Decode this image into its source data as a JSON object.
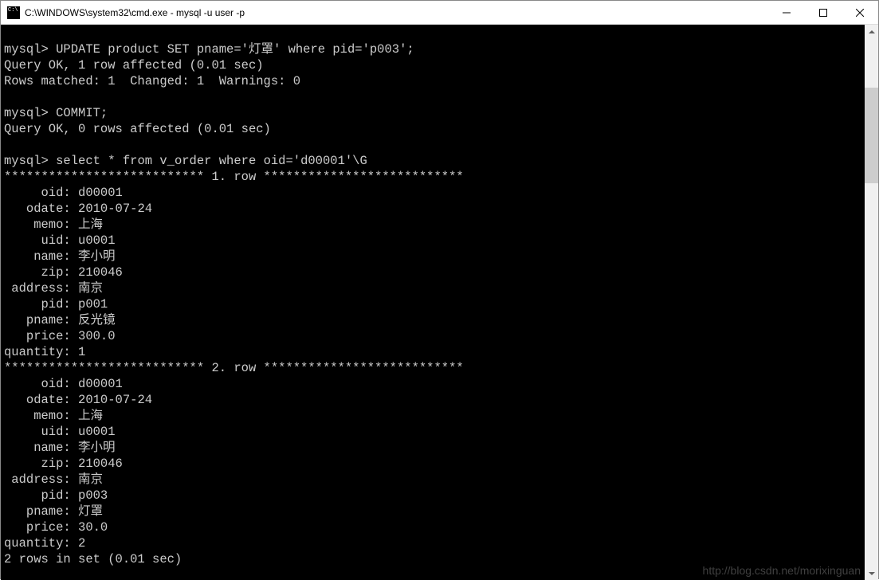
{
  "window": {
    "title": "C:\\WINDOWS\\system32\\cmd.exe - mysql  -u user -p"
  },
  "terminal": {
    "prompt": "mysql>",
    "command1": "UPDATE product SET pname='灯罩' where pid='p003';",
    "result1a": "Query OK, 1 row affected (0.01 sec)",
    "result1b": "Rows matched: 1  Changed: 1  Warnings: 0",
    "command2": "COMMIT;",
    "result2": "Query OK, 0 rows affected (0.01 sec)",
    "command3": "select * from v_order where oid='d00001'\\G",
    "row_sep_1": "*************************** 1. row ***************************",
    "row_sep_2": "*************************** 2. row ***************************",
    "row1": {
      "oid": "d00001",
      "odate": "2010-07-24",
      "memo": "上海",
      "uid": "u0001",
      "name": "李小明",
      "zip": "210046",
      "address": "南京",
      "pid": "p001",
      "pname": "反光镜",
      "price": "300.0",
      "quantity": "1"
    },
    "row2": {
      "oid": "d00001",
      "odate": "2010-07-24",
      "memo": "上海",
      "uid": "u0001",
      "name": "李小明",
      "zip": "210046",
      "address": "南京",
      "pid": "p003",
      "pname": "灯罩",
      "price": "30.0",
      "quantity": "2"
    },
    "footer": "2 rows in set (0.01 sec)"
  },
  "labels": {
    "oid": "     oid:",
    "odate": "   odate:",
    "memo": "    memo:",
    "uid": "     uid:",
    "name": "    name:",
    "zip": "     zip:",
    "address": " address:",
    "pid": "     pid:",
    "pname": "   pname:",
    "price": "   price:",
    "quantity": "quantity:"
  },
  "watermark": "http://blog.csdn.net/morixinguan"
}
